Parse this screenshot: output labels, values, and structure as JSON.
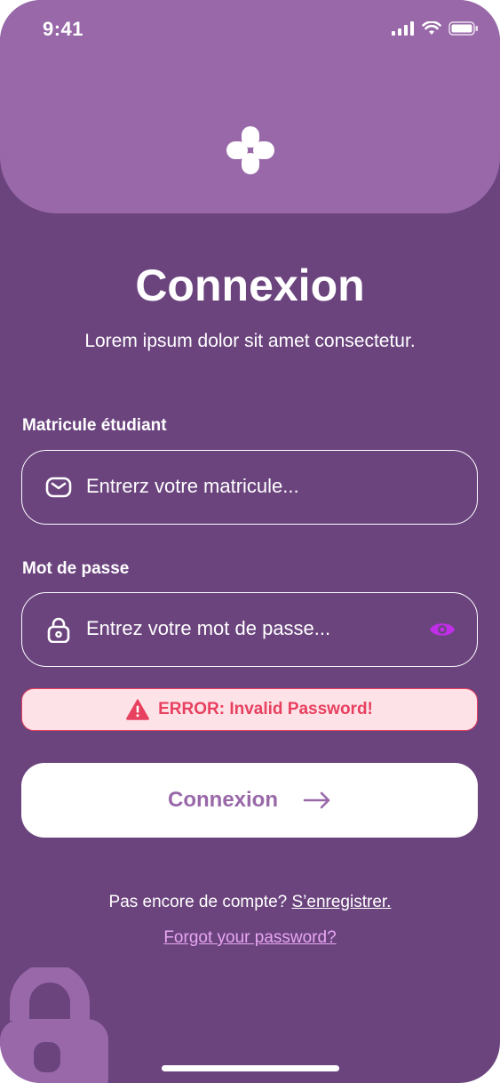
{
  "status_bar": {
    "time": "9:41"
  },
  "page": {
    "title": "Connexion",
    "subtitle": "Lorem ipsum dolor sit amet consectetur."
  },
  "matricule": {
    "label": "Matricule étudiant",
    "placeholder": "Entrerz votre matricule...",
    "value": ""
  },
  "password": {
    "label": "Mot de passe",
    "placeholder": "Entrez votre mot de passe...",
    "value": ""
  },
  "error": {
    "message": "ERROR: Invalid Password!"
  },
  "login_button": {
    "label": "Connexion"
  },
  "register": {
    "prompt": "Pas encore de compte?",
    "link": "S’enregistrer."
  },
  "forgot_password": {
    "link": "Forgot your password?"
  },
  "icons": {
    "logo": "plus-flower-icon",
    "matricule": "mail-icon",
    "password": "lock-icon",
    "toggle_visibility": "eye-icon",
    "error": "warning-triangle-icon",
    "submit": "arrow-right-icon",
    "decoration": "lock-icon"
  },
  "colors": {
    "background": "#6b447e",
    "header": "#9968a9",
    "error_text": "#e8405f",
    "error_background": "#fde3e8",
    "link_accent": "#e7a6f2",
    "eye_icon": "#c02ee8"
  }
}
